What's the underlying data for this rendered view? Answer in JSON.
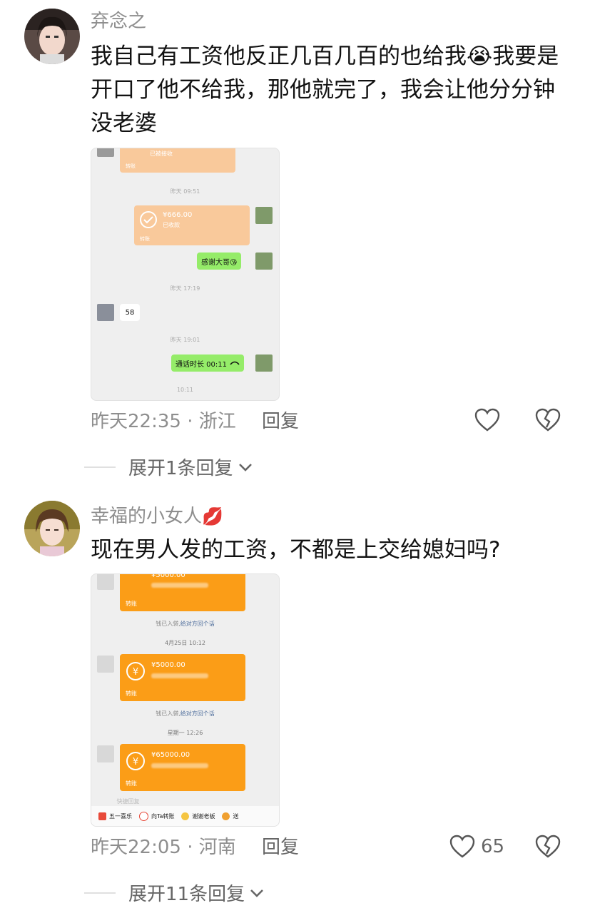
{
  "comments": [
    {
      "username": "弃念之",
      "text": "我自己有工资他反正几百几百的也给我😭我要是开口了他不给我，那他就完了，我会让他分分钟没老婆",
      "screenshot": {
        "top_status": "已被接收",
        "top_label": "转账",
        "ts1": "昨天 09:51",
        "transfer_amount": "¥666.00",
        "transfer_status": "已收款",
        "transfer_label": "转账",
        "msg_thanks": "感谢大哥😘",
        "ts2": "昨天 17:19",
        "msg_reply": "58",
        "ts3": "昨天 19:01",
        "msg_call": "通话时长 00:11",
        "bottom_time": "10:11"
      },
      "time": "昨天22:35",
      "location": "浙江",
      "reply_label": "回复",
      "likes": "",
      "expand_label": "展开1条回复"
    },
    {
      "username": "幸福的小女人",
      "username_emoji": "💋",
      "text": "现在男人发的工资，不都是上交给媳妇吗?",
      "screenshot": {
        "t1_amount": "¥5000.00",
        "t1_label": "转账",
        "sys1": "钱已入袋,",
        "sys1_link": "给对方回个话",
        "ts1": "4月25日 10:12",
        "t2_amount": "¥5000.00",
        "t2_label": "转账",
        "sys2": "钱已入袋,",
        "sys2_link": "给对方回个话",
        "ts2": "星期一 12:26",
        "t3_amount": "¥65000.00",
        "t3_label": "转账",
        "quick_hint": "快捷回复",
        "quick": [
          "五一喜乐",
          "向Ta转账",
          "谢谢老板",
          "送"
        ]
      },
      "time": "昨天22:05",
      "location": "河南",
      "reply_label": "回复",
      "likes": "65",
      "expand_label": "展开11条回复"
    }
  ],
  "icons": {
    "like": "heart-outline-icon",
    "dislike": "broken-heart-icon",
    "expand": "chevron-down-icon"
  },
  "colors": {
    "username": "#8e8e8e",
    "transfer_orange": "#fb9d17",
    "transfer_light": "#f9c99b",
    "chat_green": "#95ec69"
  }
}
